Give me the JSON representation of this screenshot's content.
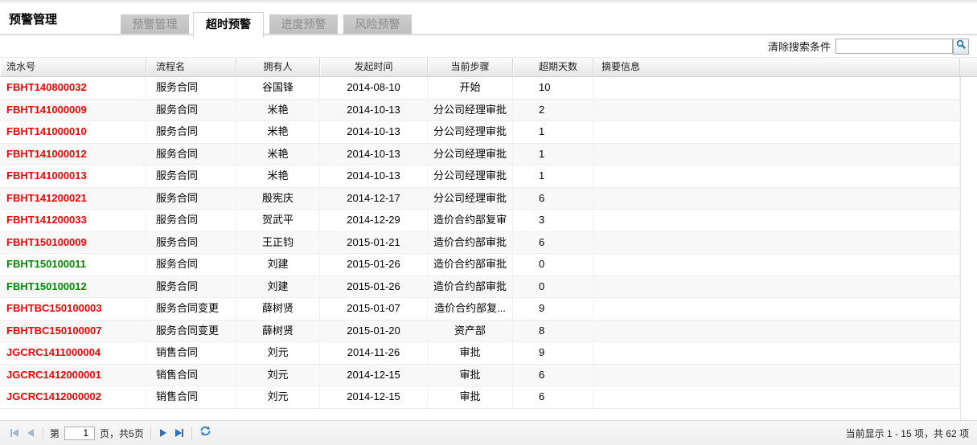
{
  "page": {
    "title": "预警管理"
  },
  "tabs": [
    {
      "label": "预警管理",
      "active": false
    },
    {
      "label": "超时预警",
      "active": true
    },
    {
      "label": "进度预警",
      "active": false
    },
    {
      "label": "风险预警",
      "active": false
    }
  ],
  "search": {
    "clear_label": "清除搜索条件",
    "input_value": "",
    "button_icon": "search-icon"
  },
  "table": {
    "columns": [
      {
        "label": "流水号"
      },
      {
        "label": "流程名"
      },
      {
        "label": "拥有人"
      },
      {
        "label": "发起时间"
      },
      {
        "label": "当前步骤"
      },
      {
        "label": "超期天数"
      },
      {
        "label": "摘要信息"
      }
    ],
    "rows": [
      {
        "serial": "FBHT140800032",
        "serial_color": "red",
        "process": "服务合同",
        "owner": "谷国锋",
        "start_date": "2014-08-10",
        "step": "开始",
        "overdue": "10",
        "summary": ""
      },
      {
        "serial": "FBHT141000009",
        "serial_color": "red",
        "process": "服务合同",
        "owner": "米艳",
        "start_date": "2014-10-13",
        "step": "分公司经理审批",
        "overdue": "2",
        "summary": ""
      },
      {
        "serial": "FBHT141000010",
        "serial_color": "red",
        "process": "服务合同",
        "owner": "米艳",
        "start_date": "2014-10-13",
        "step": "分公司经理审批",
        "overdue": "1",
        "summary": ""
      },
      {
        "serial": "FBHT141000012",
        "serial_color": "red",
        "process": "服务合同",
        "owner": "米艳",
        "start_date": "2014-10-13",
        "step": "分公司经理审批",
        "overdue": "1",
        "summary": ""
      },
      {
        "serial": "FBHT141000013",
        "serial_color": "red",
        "process": "服务合同",
        "owner": "米艳",
        "start_date": "2014-10-13",
        "step": "分公司经理审批",
        "overdue": "1",
        "summary": ""
      },
      {
        "serial": "FBHT141200021",
        "serial_color": "red",
        "process": "服务合同",
        "owner": "殷宪庆",
        "start_date": "2014-12-17",
        "step": "分公司经理审批",
        "overdue": "6",
        "summary": ""
      },
      {
        "serial": "FBHT141200033",
        "serial_color": "red",
        "process": "服务合同",
        "owner": "贺武平",
        "start_date": "2014-12-29",
        "step": "造价合约部复审",
        "overdue": "3",
        "summary": ""
      },
      {
        "serial": "FBHT150100009",
        "serial_color": "red",
        "process": "服务合同",
        "owner": "王正钧",
        "start_date": "2015-01-21",
        "step": "造价合约部审批",
        "overdue": "6",
        "summary": ""
      },
      {
        "serial": "FBHT150100011",
        "serial_color": "green",
        "process": "服务合同",
        "owner": "刘建",
        "start_date": "2015-01-26",
        "step": "造价合约部审批",
        "overdue": "0",
        "summary": ""
      },
      {
        "serial": "FBHT150100012",
        "serial_color": "green",
        "process": "服务合同",
        "owner": "刘建",
        "start_date": "2015-01-26",
        "step": "造价合约部审批",
        "overdue": "0",
        "summary": ""
      },
      {
        "serial": "FBHTBC150100003",
        "serial_color": "red",
        "process": "服务合同变更",
        "owner": "薛树贤",
        "start_date": "2015-01-07",
        "step": "造价合约部复...",
        "overdue": "9",
        "summary": ""
      },
      {
        "serial": "FBHTBC150100007",
        "serial_color": "red",
        "process": "服务合同变更",
        "owner": "薛树贤",
        "start_date": "2015-01-20",
        "step": "资产部",
        "overdue": "8",
        "summary": ""
      },
      {
        "serial": "JGCRC1411000004",
        "serial_color": "red",
        "process": "销售合同",
        "owner": "刘元",
        "start_date": "2014-11-26",
        "step": "审批",
        "overdue": "9",
        "summary": ""
      },
      {
        "serial": "JGCRC1412000001",
        "serial_color": "red",
        "process": "销售合同",
        "owner": "刘元",
        "start_date": "2014-12-15",
        "step": "审批",
        "overdue": "6",
        "summary": ""
      },
      {
        "serial": "JGCRC1412000002",
        "serial_color": "red",
        "process": "销售合同",
        "owner": "刘元",
        "start_date": "2014-12-15",
        "step": "审批",
        "overdue": "6",
        "summary": ""
      }
    ]
  },
  "pagination": {
    "page_prefix": "第",
    "page_value": "1",
    "page_suffix": "页，共5页",
    "status": "当前显示 1 - 15 项，共 62 项"
  },
  "colors": {
    "overdue_red": "#ff0000",
    "ok_green": "#008800",
    "accent_blue": "#2f6fb4",
    "disabled_blue": "#a9b7c9"
  }
}
